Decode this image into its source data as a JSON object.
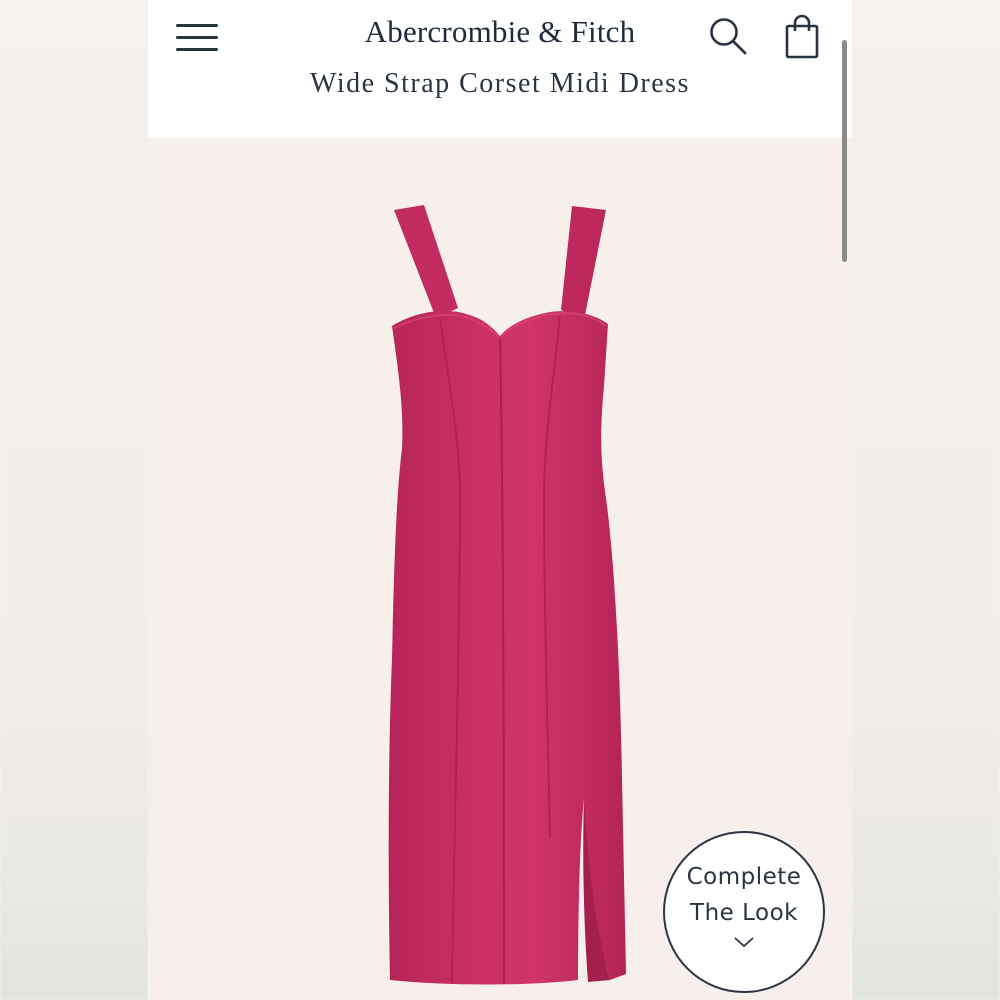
{
  "header": {
    "brand": "Abercrombie & Fitch",
    "product_title": "Wide Strap Corset Midi Dress"
  },
  "icons": {
    "menu": "hamburger-menu-icon",
    "search": "search-icon",
    "bag": "shopping-bag-icon",
    "chevron": "chevron-down-icon"
  },
  "product": {
    "image": "pink-dress-image",
    "color": "#c72d62"
  },
  "complete_look": {
    "line1": "Complete",
    "line2": "The Look"
  }
}
